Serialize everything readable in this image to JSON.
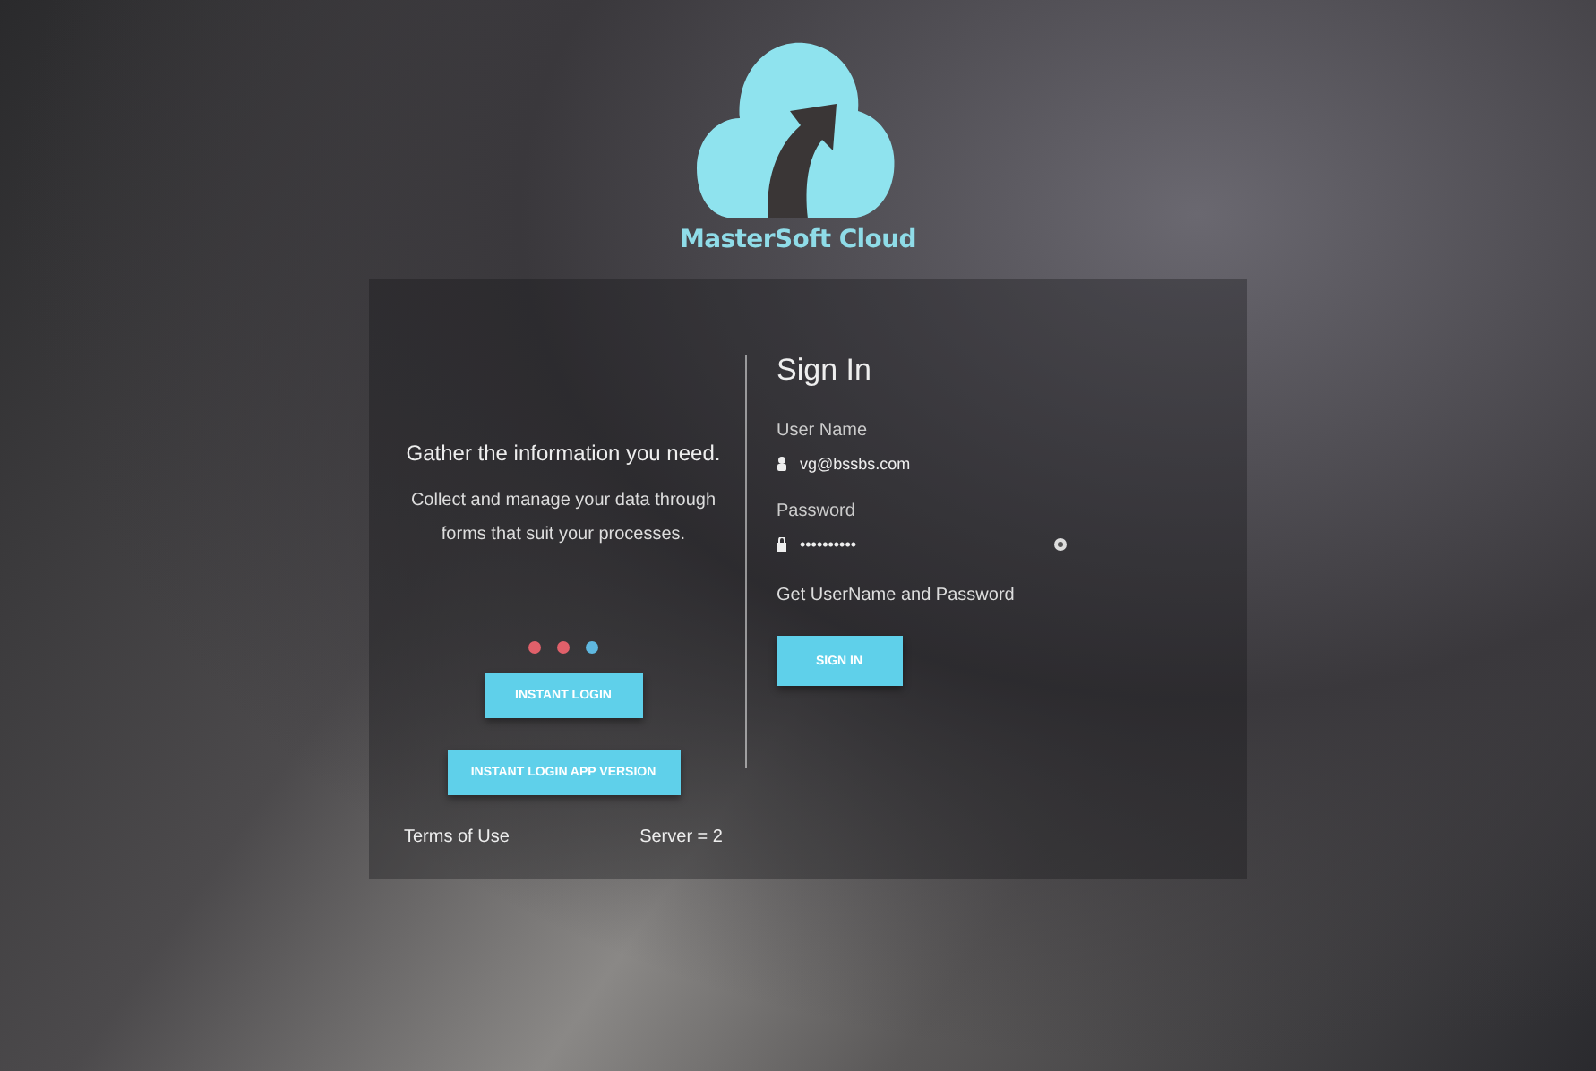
{
  "brand": {
    "name": "MasterSoft Cloud"
  },
  "intro": {
    "heading": "Gather the information you need.",
    "text": "Collect and manage your data through forms that suit your processes."
  },
  "carousel_dots": [
    {
      "color": "#e0606a"
    },
    {
      "color": "#e0606a"
    },
    {
      "color": "#5fb8e0"
    }
  ],
  "left_buttons": [
    "INSTANT LOGIN",
    "INSTANT LOGIN APP VERSION"
  ],
  "footer": {
    "terms_link": "Terms of Use",
    "server": "Server = 2"
  },
  "sign_in": {
    "title": "Sign In",
    "username": {
      "label": "User Name",
      "value": "vg@bssbs.com"
    },
    "password": {
      "label": "Password",
      "value": "••••••••••"
    },
    "help_link": "Get UserName and Password",
    "button": "SIGN IN"
  }
}
